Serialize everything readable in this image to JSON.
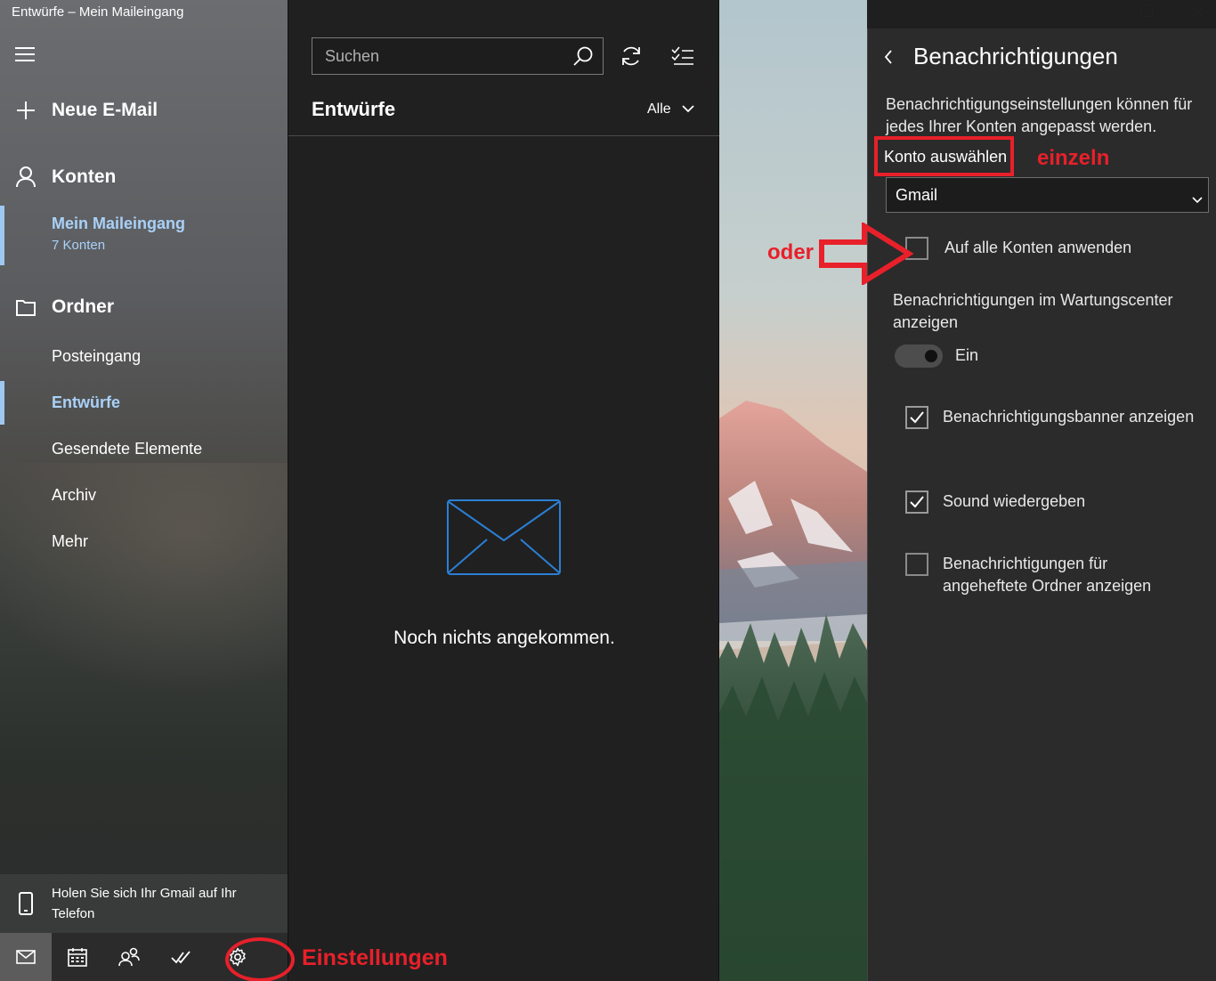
{
  "window": {
    "title": "Entwürfe – Mein Maileingang",
    "minimize_icon": "minimize-icon",
    "maximize_icon": "maximize-icon",
    "close_icon": "close-icon"
  },
  "nav": {
    "new_mail": "Neue E-Mail",
    "accounts_heading": "Konten",
    "inbox_account": {
      "name": "Mein Maileingang",
      "sub": "7 Konten"
    },
    "folders_heading": "Ordner",
    "folders": [
      "Posteingang",
      "Entwürfe",
      "Gesendete Elemente",
      "Archiv",
      "Mehr"
    ],
    "selected_folder": "Entwürfe",
    "promo": "Holen Sie sich Ihr Gmail auf Ihr Telefon",
    "bottom_icons": [
      "mail-icon",
      "calendar-icon",
      "people-icon",
      "todo-icon",
      "settings-gear-icon"
    ]
  },
  "list": {
    "search_placeholder": "Suchen",
    "folder_title": "Entwürfe",
    "filter_label": "Alle",
    "empty_message": "Noch nichts angekommen."
  },
  "settings": {
    "title": "Benachrichtigungen",
    "description": "Benachrichtigungseinstellungen können für jedes Ihrer Konten angepasst werden.",
    "account_label": "Konto auswählen",
    "account_value": "Gmail",
    "apply_all_label": "Auf alle Konten anwenden",
    "apply_all_checked": false,
    "action_center_label": "Benachrichtigungen im Wartungscenter anzeigen",
    "toggle_state": "Ein",
    "options": [
      {
        "label": "Benachrichtigungsbanner anzeigen",
        "checked": true
      },
      {
        "label": "Sound wiedergeben",
        "checked": true
      },
      {
        "label": "Benachrichtigungen für angeheftete Ordner anzeigen",
        "checked": false
      }
    ]
  },
  "annotations": {
    "einzeln": "einzeln",
    "oder": "oder",
    "einstellungen": "Einstellungen",
    "color": "#e8202a"
  },
  "colors": {
    "accent": "#a9d1f7",
    "envelope": "#2b7fd4"
  }
}
